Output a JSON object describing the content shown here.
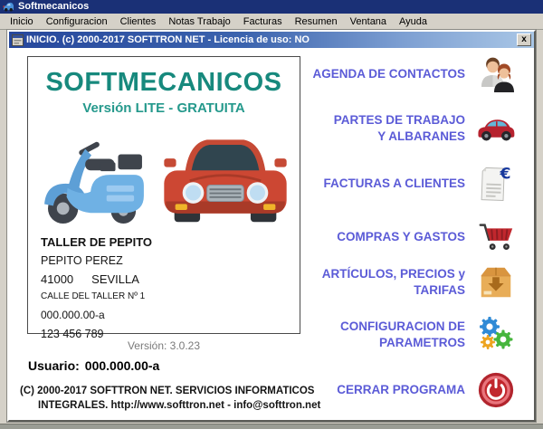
{
  "window": {
    "title": "Softmecanicos",
    "icon": "car-app-icon"
  },
  "menubar": {
    "items": [
      "Inicio",
      "Configuracion",
      "Clientes",
      "Notas Trabajo",
      "Facturas",
      "Resumen",
      "Ventana",
      "Ayuda"
    ]
  },
  "inner_window": {
    "icon": "form-window-icon",
    "title": "INICIO. (c) 2000-2017 SOFTTRON NET - Licencia de uso: NO",
    "close_label": "x"
  },
  "card": {
    "app_name": "SOFTMECANICOS",
    "edition": "Versión LITE - GRATUITA",
    "illustrations": [
      "scooter-illustration",
      "car-illustration"
    ],
    "business_name": "TALLER DE PEPITO",
    "owner": "PEPITO PEREZ",
    "postal_code": "41000",
    "city": "SEVILLA",
    "address": "CALLE DEL TALLER Nº 1",
    "tax_id": "000.000.00-a",
    "phone": "123 456 789"
  },
  "footer": {
    "version": "Versión: 3.0.23",
    "user_label": "Usuario:",
    "user_value": "000.000.00-a",
    "copyright_line1": "(C) 2000-2017 SOFTTRON NET. SERVICIOS INFORMATICOS",
    "copyright_line2": "INTEGRALES. http://www.softtron.net - info@softtron.net"
  },
  "side_menu": {
    "items": [
      {
        "line1": "AGENDA DE CONTACTOS",
        "line2": "",
        "icon": "contacts-icon"
      },
      {
        "line1": "PARTES DE TRABAJO",
        "line2": "Y ALBARANES",
        "icon": "work-orders-car-icon"
      },
      {
        "line1": "FACTURAS A CLIENTES",
        "line2": "",
        "icon": "invoice-euro-icon"
      },
      {
        "line1": "COMPRAS Y GASTOS",
        "line2": "",
        "icon": "shopping-cart-icon"
      },
      {
        "line1": "ARTÍCULOS, PRECIOS y",
        "line2": "TARIFAS",
        "icon": "stock-box-icon"
      },
      {
        "line1": "CONFIGURACION DE",
        "line2": "PARAMETROS",
        "icon": "gears-icon"
      },
      {
        "line1": "CERRAR PROGRAMA",
        "line2": "",
        "icon": "power-off-icon"
      }
    ]
  },
  "colors": {
    "brand_teal": "#17897d",
    "edition_teal": "#25998c",
    "menu_link_blue": "#5b5bd7",
    "titlebar_navy": "#1a3076",
    "inner_titlebar_left": "#26479c",
    "inner_titlebar_right": "#aac7e6",
    "version_gray": "#7a7a7a"
  }
}
